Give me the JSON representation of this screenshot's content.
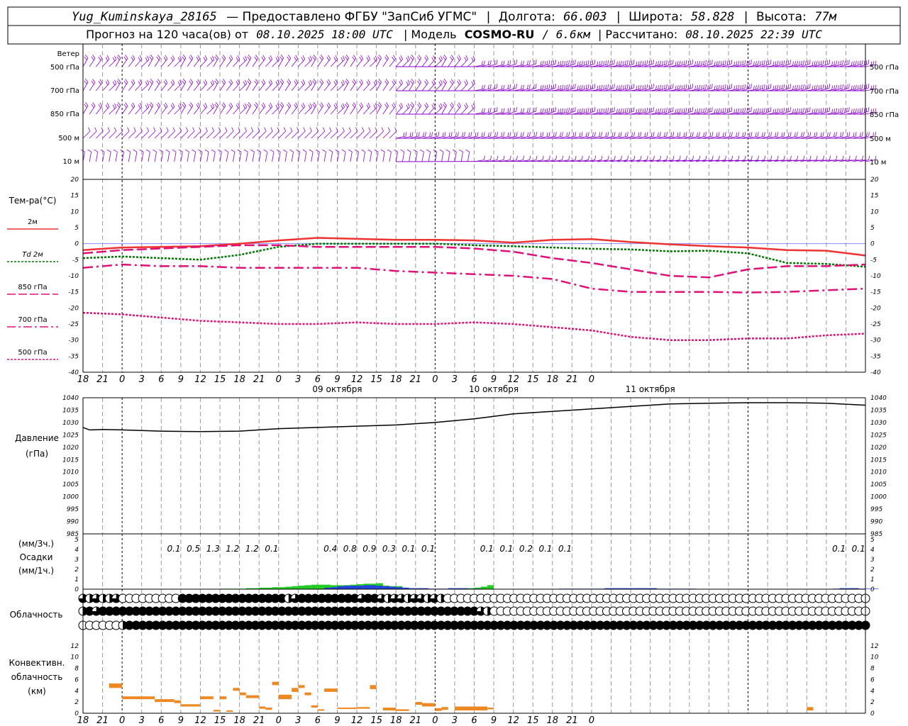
{
  "header": {
    "station": "Yug_Kuminskaya_28165",
    "provider": "— Предоставлено ФГБУ \"ЗапСиб УГМС\"",
    "lon_label": "Долгота:",
    "lon_value": "66.003",
    "lat_label": "Широта:",
    "lat_value": "58.828",
    "alt_label": "Высота:",
    "alt_value": "77м",
    "forecast_prefix": "Прогноз на 120 часа(ов)  от",
    "forecast_start": "08.10.2025 18:00 UTC",
    "model_prefix": "| Модель",
    "model_name": "COSMO-RU",
    "model_suffix": "/ 6.6км",
    "calc_label": "| Рассчитано:",
    "calc_time": "08.10.2025 22:39 UTC"
  },
  "colors": {
    "wind": "#8800cc",
    "t2m": "#ee3333",
    "td2m": "#007700",
    "t_levels": "#dd1177",
    "pressure": "#000000",
    "precip_green": "#22cc22",
    "precip_blue": "#2244dd",
    "convective": "#ee8822",
    "grid": "#999999"
  },
  "chart_data": [
    {
      "type": "wind-barbs",
      "title": "Ветер",
      "levels": [
        "500 гПа",
        "700 гПа",
        "850 гПа",
        "500 м",
        "10  м"
      ]
    },
    {
      "type": "line",
      "ylabel": "Тем-ра(°C)",
      "ylim": [
        -40,
        20
      ],
      "yticks": [
        20,
        15,
        10,
        5,
        0,
        -5,
        -10,
        -15,
        -20,
        -25,
        -30,
        -35,
        -40
      ],
      "x_hours": [
        0,
        6,
        12,
        18,
        24,
        30,
        36,
        42,
        48,
        54,
        60,
        66,
        72,
        78,
        84,
        90,
        96,
        102,
        108,
        114,
        120
      ],
      "series": [
        {
          "name": "2м",
          "values": [
            -2,
            -1.2,
            -1,
            -0.8,
            0,
            1,
            1.8,
            1.5,
            1.2,
            1.2,
            1,
            0.3,
            1.2,
            1.4,
            0.5,
            -0.2,
            -0.8,
            -1.2,
            -2,
            -2.2,
            -3.7
          ]
        },
        {
          "name": "Td  2м",
          "values": [
            -4.5,
            -4,
            -4.5,
            -5,
            -3.5,
            -1,
            0,
            0,
            0,
            0,
            -0.5,
            -0.8,
            -1.2,
            -1.6,
            -1.8,
            -2.4,
            -2.2,
            -3,
            -6,
            -6.3,
            -7.2
          ]
        },
        {
          "name": "850 гПа",
          "values": [
            -3,
            -2,
            -1.5,
            -1,
            -0.5,
            -0.5,
            -1,
            -1,
            -1,
            -1,
            -1.5,
            -2.5,
            -4.5,
            -6,
            -8,
            -10,
            -10.5,
            -8,
            -7,
            -7,
            -6.5
          ]
        },
        {
          "name": "700 гПа",
          "values": [
            -7.5,
            -6.5,
            -7,
            -7,
            -7.5,
            -7.5,
            -7.5,
            -7.5,
            -8.5,
            -9,
            -9.5,
            -10,
            -11,
            -14,
            -15,
            -15,
            -15,
            -15.2,
            -15,
            -14.5,
            -14
          ]
        },
        {
          "name": "500 гПа",
          "values": [
            -21.5,
            -22,
            -23,
            -24,
            -24.5,
            -25,
            -25,
            -24.5,
            -25,
            -25,
            -24.5,
            -25,
            -26,
            -27,
            -29,
            -30,
            -30,
            -29.5,
            -29.5,
            -28.5,
            -28
          ]
        }
      ]
    },
    {
      "type": "line",
      "ylabel": "Давление",
      "yunit": "(гПа)",
      "ylim": [
        985,
        1040
      ],
      "yticks": [
        1040,
        1035,
        1030,
        1025,
        1020,
        1015,
        1010,
        1005,
        1000,
        995,
        990,
        985
      ],
      "x_hours": [
        0,
        1,
        3,
        6,
        12,
        18,
        24,
        30,
        36,
        42,
        48,
        54,
        60,
        66,
        72,
        78,
        84,
        90,
        96,
        102,
        108,
        114,
        120
      ],
      "values": [
        1028,
        1027,
        1027.2,
        1027,
        1026.5,
        1026.3,
        1026.5,
        1027.5,
        1028,
        1028.5,
        1029,
        1030,
        1031.5,
        1033.5,
        1034.5,
        1035.5,
        1036.5,
        1037.5,
        1037.8,
        1038,
        1038,
        1037.8,
        1037
      ]
    },
    {
      "type": "bar",
      "ylabel": "Осадки",
      "yunit_top": "(мм/3ч.)",
      "yunit_bottom": "(мм/1ч.)",
      "ylim": [
        0,
        5
      ],
      "yticks": [
        5,
        4,
        3,
        2,
        1,
        0
      ],
      "totals_3h": [
        {
          "hour": 9,
          "label": "0.1"
        },
        {
          "hour": 12,
          "label": "0.5"
        },
        {
          "hour": 15,
          "label": "1.3"
        },
        {
          "hour": 18,
          "label": "1.2"
        },
        {
          "hour": 21,
          "label": "1.2"
        },
        {
          "hour": 24,
          "label": "0.1"
        },
        {
          "hour": 33,
          "label": "0.4"
        },
        {
          "hour": 36,
          "label": "0.8"
        },
        {
          "hour": 39,
          "label": "0.9"
        },
        {
          "hour": 42,
          "label": "0.3"
        },
        {
          "hour": 45,
          "label": "0.1"
        },
        {
          "hour": 48,
          "label": "0.1"
        },
        {
          "hour": 57,
          "label": "0.1"
        },
        {
          "hour": 60,
          "label": "0.1"
        },
        {
          "hour": 63,
          "label": "0.2"
        },
        {
          "hour": 66,
          "label": "0.1"
        },
        {
          "hour": 69,
          "label": "0.1"
        },
        {
          "hour": 111,
          "label": "0.1"
        },
        {
          "hour": 114,
          "label": "0.1"
        }
      ],
      "hourly_green": [
        0,
        0,
        0,
        0,
        0,
        0,
        0,
        0,
        0,
        0,
        0,
        0,
        0,
        0,
        0,
        0,
        0,
        0,
        0,
        0,
        0,
        0.05,
        0.05,
        0.05,
        0.05,
        0.1,
        0.1,
        0.15,
        0.15,
        0.2,
        0.2,
        0.25,
        0.3,
        0.35,
        0.4,
        0.45,
        0.45,
        0.45,
        0.4,
        0.4,
        0.4,
        0.45,
        0.5,
        0.55,
        0.55,
        0.6,
        0.35,
        0.3,
        0.3,
        0,
        0,
        0,
        0,
        0,
        0,
        0,
        0,
        0,
        0.05,
        0.1,
        0.15,
        0.25,
        0.4
      ],
      "hourly_blue": [
        0,
        0.15,
        0.2,
        0.3,
        0.35,
        0.35,
        0.35,
        0.4,
        0.4,
        0.35,
        0.3,
        0.25,
        0.2,
        0.15,
        0.1,
        0.1,
        0.1,
        0.05,
        0.05,
        0.05,
        0.1,
        0.1,
        0.1,
        0.05,
        0.05,
        0,
        0,
        0,
        0,
        0,
        0,
        0,
        0,
        0,
        0,
        0,
        0,
        0.05,
        0.05,
        0.05,
        0.05,
        0.05,
        0.05,
        0.05,
        0.1,
        0.1,
        0.1,
        0.1,
        0.1,
        0.1,
        0.1,
        0.1,
        0.05,
        0.05,
        0.05,
        0.05,
        0.05,
        0.05,
        0,
        0,
        0,
        0,
        0,
        0,
        0,
        0,
        0,
        0,
        0,
        0,
        0,
        0,
        0,
        0,
        0,
        0,
        0,
        0,
        0,
        0.05,
        0.1,
        0.1,
        0.1,
        0.05,
        0.05,
        0.05
      ]
    },
    {
      "type": "cloud-circles",
      "ylabel": "Облачность",
      "rows": [
        [
          3,
          2,
          3,
          2,
          2,
          3,
          0,
          0,
          0,
          0,
          0,
          0,
          0,
          0,
          0,
          4,
          4,
          4,
          4,
          4,
          4,
          4,
          4,
          4,
          4,
          4,
          4,
          4,
          4,
          4,
          4,
          2,
          3,
          4,
          4,
          4,
          4,
          4,
          4,
          4,
          4,
          4,
          3,
          4,
          4,
          3,
          2,
          3,
          3,
          2,
          3,
          3,
          2,
          3,
          2,
          0,
          0,
          0,
          0,
          0,
          0,
          0,
          0,
          0,
          0,
          0,
          0,
          0,
          0,
          0,
          0,
          0,
          0,
          0,
          0,
          0,
          0,
          0,
          0,
          0,
          0,
          0,
          0,
          0,
          0,
          0,
          0,
          0,
          0,
          0,
          0,
          0,
          0,
          0,
          0,
          0,
          0,
          0,
          0,
          0,
          0,
          0,
          0,
          0,
          0,
          0,
          0,
          0,
          0,
          0,
          0,
          0,
          0,
          0,
          0,
          0,
          0,
          0,
          0
        ],
        [
          2,
          4,
          3,
          4,
          4,
          4,
          4,
          4,
          4,
          4,
          4,
          4,
          4,
          4,
          4,
          4,
          4,
          4,
          4,
          4,
          4,
          4,
          4,
          4,
          4,
          4,
          4,
          4,
          4,
          4,
          4,
          4,
          4,
          4,
          4,
          4,
          4,
          4,
          4,
          4,
          4,
          4,
          4,
          4,
          4,
          4,
          4,
          4,
          4,
          4,
          4,
          4,
          4,
          4,
          4,
          4,
          4,
          4,
          4,
          4,
          3,
          2,
          0,
          0,
          0,
          0,
          0,
          0,
          0,
          0,
          0,
          0,
          0,
          0,
          0,
          0,
          0,
          0,
          0,
          0,
          0,
          0,
          0,
          0,
          0,
          0,
          0,
          0,
          0,
          0,
          0,
          0,
          0,
          0,
          0,
          0,
          0,
          0,
          0,
          0,
          0,
          0,
          0,
          0,
          0,
          0,
          0,
          0,
          0,
          0,
          0,
          0,
          0,
          0,
          0,
          0,
          0,
          0,
          0
        ],
        [
          0,
          0,
          0,
          0,
          0,
          0,
          2,
          4,
          4,
          4,
          4,
          4,
          4,
          4,
          4,
          4,
          4,
          4,
          4,
          4,
          4,
          4,
          4,
          4,
          4,
          4,
          4,
          4,
          4,
          4,
          4,
          4,
          4,
          4,
          4,
          4,
          4,
          4,
          4,
          4,
          4,
          4,
          4,
          4,
          4,
          4,
          4,
          4,
          4,
          4,
          4,
          4,
          4,
          4,
          4,
          4,
          4,
          4,
          4,
          4,
          4,
          4,
          4,
          4,
          4,
          4,
          4,
          4,
          4,
          4,
          4,
          4,
          4,
          4,
          4,
          4,
          4,
          4,
          4,
          4,
          4,
          4,
          4,
          4,
          4,
          4,
          4,
          4,
          4,
          4,
          4,
          4,
          4,
          4,
          4,
          4,
          4,
          4,
          4,
          4,
          4,
          4,
          4,
          4,
          4,
          4,
          4,
          4,
          4,
          4,
          4,
          4,
          4,
          4,
          4,
          4,
          4,
          4,
          4
        ]
      ]
    },
    {
      "type": "bar",
      "ylabel": "Конвективн.",
      "ylabel2": "облачность",
      "yunit": "(км)",
      "ylim": [
        0,
        14
      ],
      "yticks": [
        12,
        10,
        8,
        6,
        4,
        2,
        0
      ],
      "segments": [
        {
          "start": 4,
          "end": 6,
          "bottom": 4.5,
          "top": 5.3
        },
        {
          "start": 6,
          "end": 8,
          "bottom": 2.5,
          "top": 3
        },
        {
          "start": 8,
          "end": 11,
          "bottom": 2.5,
          "top": 3
        },
        {
          "start": 11,
          "end": 12,
          "bottom": 2,
          "top": 2.5
        },
        {
          "start": 12,
          "end": 14,
          "bottom": 2,
          "top": 2.5
        },
        {
          "start": 14,
          "end": 15,
          "bottom": 1.8,
          "top": 2.3
        },
        {
          "start": 15,
          "end": 18,
          "bottom": 1.2,
          "top": 1.6
        },
        {
          "start": 18,
          "end": 20,
          "bottom": 2.5,
          "top": 3
        },
        {
          "start": 20,
          "end": 21,
          "bottom": 0.3,
          "top": 0.6
        },
        {
          "start": 21,
          "end": 22,
          "bottom": 2.5,
          "top": 3
        },
        {
          "start": 22,
          "end": 23,
          "bottom": 0.3,
          "top": 0.5
        },
        {
          "start": 23,
          "end": 24,
          "bottom": 4,
          "top": 4.5
        },
        {
          "start": 24,
          "end": 25,
          "bottom": 3.2,
          "top": 3.7
        },
        {
          "start": 25,
          "end": 27,
          "bottom": 2.7,
          "top": 3.2
        },
        {
          "start": 27,
          "end": 28,
          "bottom": 0.8,
          "top": 1.2
        },
        {
          "start": 28,
          "end": 29,
          "bottom": 0.6,
          "top": 1
        },
        {
          "start": 29,
          "end": 30,
          "bottom": 5,
          "top": 5.6
        },
        {
          "start": 30,
          "end": 32,
          "bottom": 2.5,
          "top": 3.3
        },
        {
          "start": 32,
          "end": 33,
          "bottom": 3.8,
          "top": 4.5
        },
        {
          "start": 33,
          "end": 34,
          "bottom": 4.5,
          "top": 5
        },
        {
          "start": 34,
          "end": 35,
          "bottom": 3.2,
          "top": 3.7
        },
        {
          "start": 35,
          "end": 36,
          "bottom": 1,
          "top": 1.4
        },
        {
          "start": 36,
          "end": 37,
          "bottom": 0.5,
          "top": 0.7
        },
        {
          "start": 37,
          "end": 39,
          "bottom": 3.8,
          "top": 4.4
        },
        {
          "start": 39,
          "end": 42,
          "bottom": 0.8,
          "top": 1
        },
        {
          "start": 42,
          "end": 44,
          "bottom": 0.8,
          "top": 1.1
        },
        {
          "start": 44,
          "end": 45,
          "bottom": 4.3,
          "top": 5
        },
        {
          "start": 46,
          "end": 48,
          "bottom": 0.5,
          "top": 1
        },
        {
          "start": 48,
          "end": 50,
          "bottom": 0.4,
          "top": 0.7
        },
        {
          "start": 51,
          "end": 52,
          "bottom": 1.5,
          "top": 2
        },
        {
          "start": 52,
          "end": 54,
          "bottom": 1.2,
          "top": 1.8
        },
        {
          "start": 54,
          "end": 55,
          "bottom": 0.4,
          "top": 0.9
        },
        {
          "start": 55,
          "end": 56,
          "bottom": 0.6,
          "top": 1.1
        },
        {
          "start": 57,
          "end": 62,
          "bottom": 0.5,
          "top": 1.2
        },
        {
          "start": 62,
          "end": 63,
          "bottom": 0.7,
          "top": 1
        },
        {
          "start": 111,
          "end": 112,
          "bottom": 0.5,
          "top": 1.1
        }
      ]
    }
  ],
  "xaxis": {
    "hour_labels": [
      "18",
      "21",
      "0",
      "3",
      "6",
      "9",
      "12",
      "15",
      "18",
      "21",
      "0",
      "3",
      "6",
      "9",
      "12",
      "15",
      "18",
      "21",
      "0",
      "3",
      "6",
      "9",
      "12",
      "15",
      "18",
      "21",
      "0"
    ],
    "dates": [
      {
        "hour": 33,
        "label": "09 октября"
      },
      {
        "hour": 57,
        "label": "10 октября"
      },
      {
        "hour": 81,
        "label": "11 октября"
      }
    ]
  }
}
